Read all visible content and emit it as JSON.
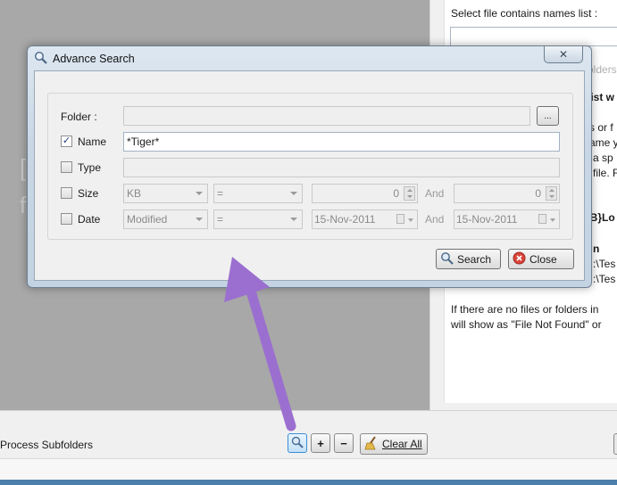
{
  "window": {
    "ghost_lines": [
      "[",
      "f"
    ],
    "right_panel": {
      "select_file_label": "Select file contains names list :",
      "faded_text": "olders",
      "partial_heading": "list w",
      "lines": [
        "s or f",
        "ame y",
        "a sp",
        "file. F"
      ],
      "var_heading": "AB}Lo",
      "n_heading": "n",
      "paths": [
        ":\\Tes",
        ":\\Tes"
      ],
      "footer_lines": [
        "If there are no files or folders in",
        "will show as \"File Not Found\" or"
      ]
    },
    "bottom": {
      "process_subfolders": "Process Subfolders",
      "add_label": "+",
      "remove_label": "−",
      "clear_all_label": "Clear All"
    }
  },
  "dialog": {
    "title": "Advance Search",
    "close_glyph": "✕",
    "folder": {
      "label": "Folder :",
      "value": "",
      "browse_label": "..."
    },
    "name": {
      "label": "Name",
      "checked": true,
      "value": "*Tiger*"
    },
    "type": {
      "label": "Type",
      "checked": false,
      "value": ""
    },
    "size": {
      "label": "Size",
      "checked": false,
      "unit": "KB",
      "operator": "=",
      "from_value": "0",
      "and_label": "And",
      "to_value": "0"
    },
    "date": {
      "label": "Date",
      "checked": false,
      "kind": "Modified",
      "operator": "=",
      "from_date": "15-Nov-2011",
      "and_label": "And",
      "to_date": "15-Nov-2011"
    },
    "search_button": "Search",
    "close_button": "Close"
  },
  "colors": {
    "annotation_arrow": "#9b6fd0",
    "dialog_frame": "#c9d7e5",
    "close_icon_red": "#d9453a"
  }
}
